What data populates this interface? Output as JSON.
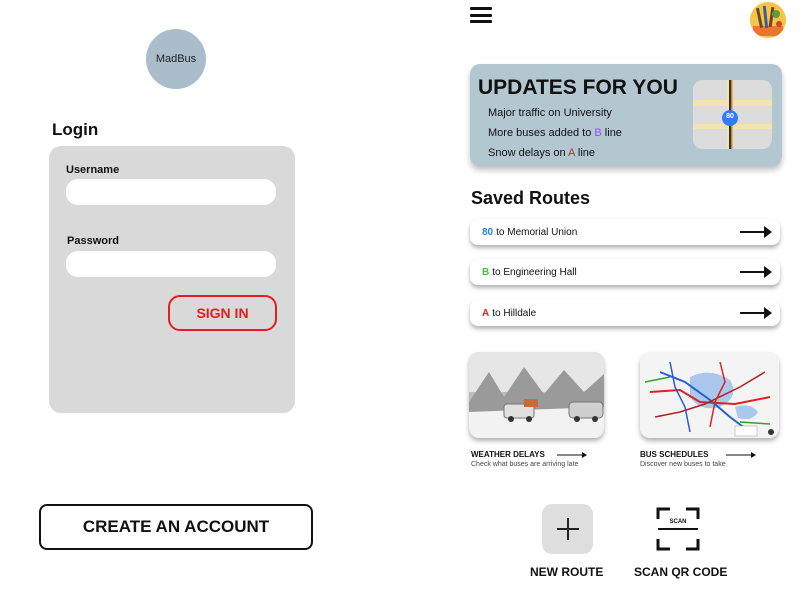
{
  "login": {
    "logo_text": "MadBus",
    "title": "Login",
    "username_label": "Username",
    "username_value": "",
    "password_label": "Password",
    "password_value": "",
    "signin_label": "SIGN IN",
    "create_account_label": "CREATE AN ACCOUNT",
    "accent_color": "#e81c1c"
  },
  "home": {
    "menu_icon": "hamburger-icon",
    "updates": {
      "title": "UPDATES FOR YOU",
      "items": [
        {
          "before": "Major traffic on University",
          "highlight": "",
          "after": "",
          "color": ""
        },
        {
          "before": "More buses added to ",
          "highlight": "B",
          "after": " line",
          "color": "#9b4dff"
        },
        {
          "before": "Snow delays on ",
          "highlight": "A",
          "after": " line",
          "color": "#e81c1c"
        }
      ],
      "map_badge": "80"
    },
    "saved_routes": {
      "title": "Saved Routes",
      "routes": [
        {
          "code": "80",
          "destination": "to Memorial Union",
          "color": "#2f7cf6"
        },
        {
          "code": "B",
          "destination": "to Engineering Hall",
          "color": "#3cc43c"
        },
        {
          "code": "A",
          "destination": "to Hilldale",
          "color": "#e81c1c"
        }
      ]
    },
    "cards": [
      {
        "title": "WEATHER DELAYS",
        "subtitle": "Check what buses are arriving late"
      },
      {
        "title": "BUS SCHEDULES",
        "subtitle": "Discover new buses to take"
      }
    ],
    "actions": {
      "new_route_label": "NEW ROUTE",
      "scan_label": "SCAN QR CODE",
      "scan_icon_text": "SCAN"
    }
  }
}
